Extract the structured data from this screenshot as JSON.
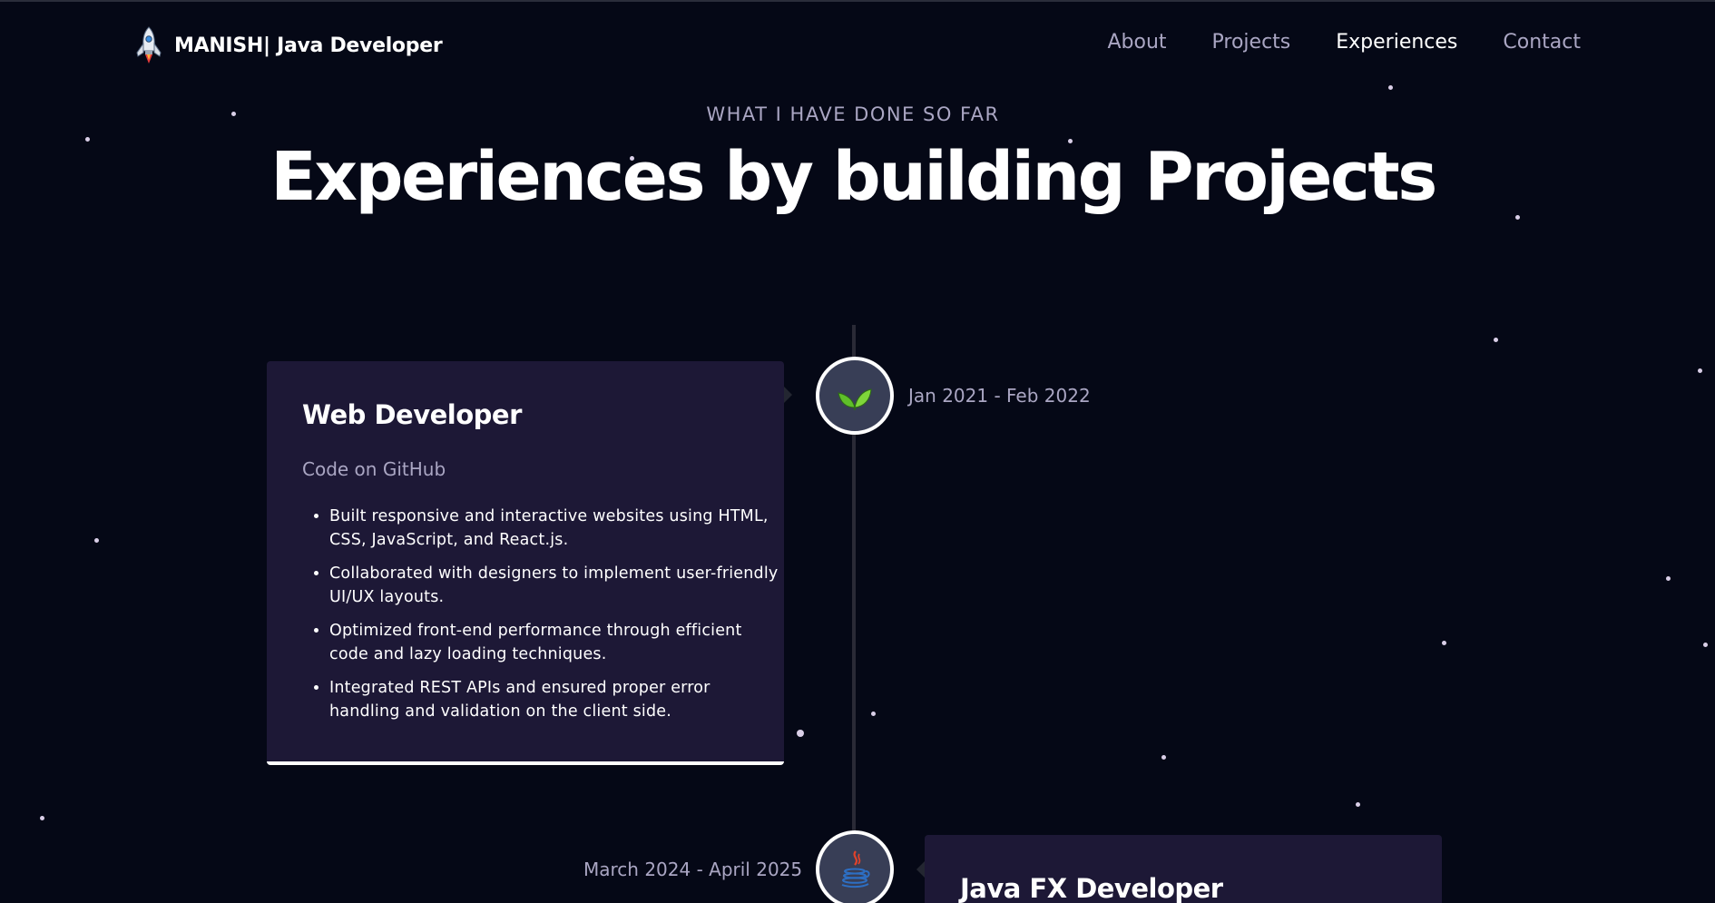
{
  "nav": {
    "brand": "MANISH| Java Developer",
    "links": [
      {
        "label": "About"
      },
      {
        "label": "Projects"
      },
      {
        "label": "Experiences"
      },
      {
        "label": "Contact"
      }
    ],
    "active": "Experiences"
  },
  "section": {
    "subtitle": "WHAT I HAVE DONE SO FAR",
    "title": "Experiences by building Projects"
  },
  "experiences": [
    {
      "title": "Web Developer",
      "link_text": "Code on GitHub",
      "date": "Jan 2021 - Feb 2022",
      "icon": "leaf-icon",
      "points": [
        "Built responsive and interactive websites using HTML, CSS, JavaScript, and React.js.",
        "Collaborated with designers to implement user-friendly UI/UX layouts.",
        "Optimized front-end performance through efficient code and lazy loading techniques.",
        "Integrated REST APIs and ensured proper error handling and validation on the client side."
      ]
    },
    {
      "title": "Java FX Developer",
      "date": "March 2024 - April 2025",
      "icon": "java-coffee-icon"
    }
  ],
  "colors": {
    "background": "#050816",
    "card": "#1d1836",
    "secondary_text": "#aaa6c3",
    "icon_bg": "#383e56",
    "timeline_line": "#2a2a36"
  }
}
